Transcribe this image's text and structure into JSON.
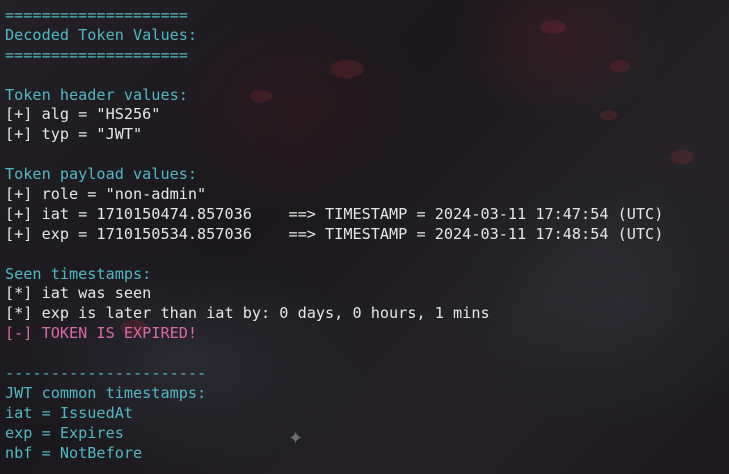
{
  "terminal": {
    "colors": {
      "header": "#4fb8c6",
      "text": "#e6e6e6",
      "error": "#d96aa8"
    },
    "lines": [
      {
        "text": "====================",
        "style": "header"
      },
      {
        "text": "Decoded Token Values:",
        "style": "header"
      },
      {
        "text": "====================",
        "style": "header"
      },
      {
        "text": "",
        "style": "plain"
      },
      {
        "text": "Token header values:",
        "style": "header"
      },
      {
        "text": "[+] alg = \"HS256\"",
        "style": "plain"
      },
      {
        "text": "[+] typ = \"JWT\"",
        "style": "plain"
      },
      {
        "text": "",
        "style": "plain"
      },
      {
        "text": "Token payload values:",
        "style": "header"
      },
      {
        "text": "[+] role = \"non-admin\"",
        "style": "plain"
      },
      {
        "text": "[+] iat = 1710150474.857036    ==> TIMESTAMP = 2024-03-11 17:47:54 (UTC)",
        "style": "plain"
      },
      {
        "text": "[+] exp = 1710150534.857036    ==> TIMESTAMP = 2024-03-11 17:48:54 (UTC)",
        "style": "plain"
      },
      {
        "text": "",
        "style": "plain"
      },
      {
        "text": "Seen timestamps:",
        "style": "header"
      },
      {
        "text": "[*] iat was seen",
        "style": "plain"
      },
      {
        "text": "[*] exp is later than iat by: 0 days, 0 hours, 1 mins",
        "style": "plain"
      },
      {
        "text": "[-] TOKEN IS EXPIRED!",
        "style": "expired"
      },
      {
        "text": "",
        "style": "plain"
      },
      {
        "text": "----------------------",
        "style": "header"
      },
      {
        "text": "JWT common timestamps:",
        "style": "header"
      },
      {
        "text": "iat = IssuedAt",
        "style": "header"
      },
      {
        "text": "exp = Expires",
        "style": "header"
      },
      {
        "text": "nbf = NotBefore",
        "style": "header"
      }
    ]
  }
}
